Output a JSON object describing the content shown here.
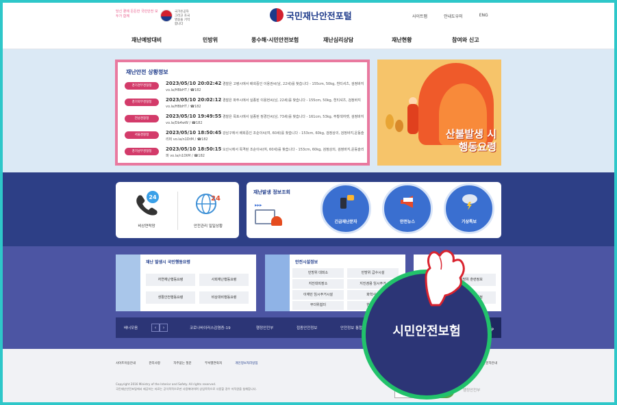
{
  "header": {
    "slogan": "당신 곁에 든든한 국민안전 모두가 함께",
    "flag_text": "국가유공자 그리고 호국영웅을 기억합니다",
    "site_title": "국민재난안전포털",
    "util": [
      "사이트맵",
      "안내도우미",
      "ENG"
    ]
  },
  "gnb": [
    "재난예방대비",
    "민방위",
    "풍수해·시민안전보험",
    "재난심리상담",
    "재난현황",
    "참여와 신고"
  ],
  "situation": {
    "title": "재난안전 상황정보",
    "items": [
      {
        "tag": "경기경부경찰청",
        "date": "2023/05/10 20:02:42",
        "text": "경찰은 고령시에서 배회중인 이용권씨(남, 22세)를 찾습니다 - 155cm, 50kg, 흰티셔츠, 검정바지 vo.la/HBbHT / ☎182"
      },
      {
        "tag": "경기북부경찰청",
        "date": "2023/05/10 20:02:12",
        "text": "경찰은 파주시에서 실종된 이용현씨(남, 22세)를 찾습니다 - 155cm, 50kg, 흰티셔츠, 검정바지 vo.la/HBbHT / ☎182"
      },
      {
        "tag": "전남경찰청",
        "date": "2023/05/10 19:49:55",
        "date_short": "",
        "text": "경찰은 목포시에서 실종된 정경진씨(남, 73세)를 찾습니다 - 161cm, 53kg, 주황색자켓, 검정바지 vo.la/Db4wW / ☎182"
      },
      {
        "tag": "서울경찰청",
        "date": "2023/05/10 18:50:45",
        "text": "강남구에서 배회중인 조순이씨(여, 60세)를 찾습니다 - 153cm, 60kg, 검정상의, 검정바지,운동슬리퍼 vo.la/n1DtM / ☎182"
      },
      {
        "tag": "경기남부경찰청",
        "date": "2023/05/10 18:50:15",
        "text": "오산시에서 목격된 조순이씨(여, 60세)를 찾습니다 - 153cm, 60kg, 검정상의, 검정바지,운동슬리퍼 vo.la/n1DtM / ☎182"
      }
    ]
  },
  "fire_banner": {
    "line1": "산불발생 시",
    "line2": "행동요령"
  },
  "emergency": {
    "items": [
      {
        "label": "비상연락망",
        "badge": "24"
      },
      {
        "label": "안전관리 일일상황",
        "badge": "24"
      }
    ]
  },
  "disaster_lookup": {
    "title": "재난발생 정보조회",
    "circles": [
      "긴급재난문자",
      "안전뉴스",
      "기상특보"
    ]
  },
  "behavior": {
    "title": "재난 발생시 국민행동요령",
    "buttons": [
      "자연재난행동요령",
      "사회재난행동요령",
      "생활안전행동요령",
      "비상대비행동요령"
    ]
  },
  "facility": {
    "title": "안전시설정보",
    "buttons": [
      "민방위 대피소",
      "민방위 급수시설",
      "지진대피장소",
      "지진겸용 임시주거",
      "이재민 임시주거시설",
      "화학사고",
      "무더위쉼터",
      "한파쉼터"
    ]
  },
  "third_box": {
    "title": "",
    "buttons": [
      "민방위 훈련정보",
      "민방위 교육일정"
    ]
  },
  "banner_bar": {
    "label": "배너모음",
    "items": [
      "코로나바이러스감염증-19",
      "행정안전부",
      "접종안전정보",
      "안전정보 통합공개"
    ],
    "top": "TOP"
  },
  "footer": {
    "links": [
      "사이트이용안내",
      "관리사항",
      "자주묻는 질문",
      "부서별연락처",
      "개인정보처리방침"
    ],
    "copyright": "Copyright 2016 Ministry of the Interior and Safety. All rights reserved.",
    "notice": "국민재난안전포털에서 제공하는 자료는 공익목적으로만 사용해야하며 상업목적으로 사용할 경우 저작권을 침해합니다.",
    "right_link": "재난문자안내",
    "cbe": "CBE1",
    "wa": "WA",
    "ministry": "행정안전부"
  },
  "zoom": {
    "text": "시민안전보험"
  },
  "colors": {
    "accent": "#1d3a8a",
    "pink": "#e9799f",
    "navy": "#2d3f86",
    "purple": "#4c55a3",
    "highlight": "#22c26b"
  }
}
